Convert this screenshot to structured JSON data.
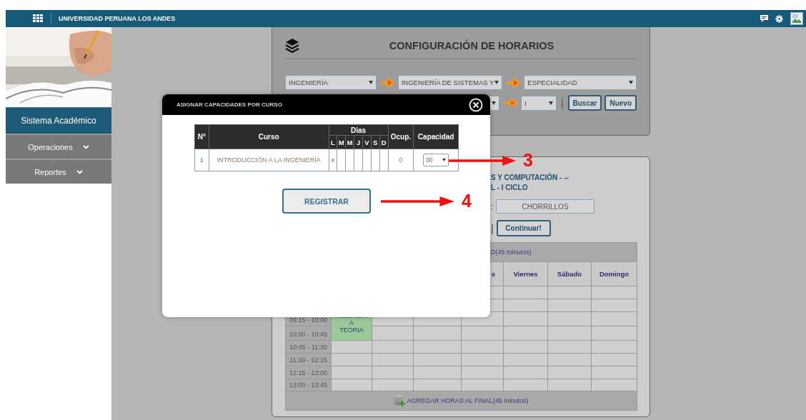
{
  "topbar": {
    "title": "UNIVERSIDAD PERUANA LOS ANDES"
  },
  "sidebar": {
    "header": "Sistema Académico",
    "items": [
      {
        "label": "Operaciones",
        "expanded": false
      },
      {
        "label": "Reportes",
        "expanded": false
      }
    ]
  },
  "config": {
    "title": "CONFIGURACIÓN DE HORARIOS",
    "row1": [
      "INGENIERÍA",
      "INGENIERÍA DE SISTEMAS Y",
      "ESPECIALIDAD"
    ],
    "row2_select": "I",
    "separator": "|",
    "buttons": [
      "Buscar",
      "Nuevo"
    ]
  },
  "schedule": {
    "heading_lines": [
      "S Y COMPUTACIÓN - --",
      "L - I CICLO"
    ],
    "location_label": ":",
    "location_value": "CHORRILLOS",
    "separator": "|",
    "continue_button": "Continuar!",
    "add_start_link": "D(45 minutos)",
    "days": [
      "s",
      "Viernes",
      "Sábado",
      "Domingo"
    ],
    "rows": [
      {
        "time": "09:15 - 10:00",
        "course": "INGENIERI\nA\nTEORIA"
      },
      {
        "time": "10:00 - 10:45"
      },
      {
        "time": "10:45 - 11:30"
      },
      {
        "time": "11:30 - 12:15"
      },
      {
        "time": "12:15 - 13:00"
      },
      {
        "time": "13:00 - 13:45"
      }
    ],
    "add_end_link": "AGREGAR HORAS AL FINAL(45 minutos)"
  },
  "dialog": {
    "title": "ASIGNAR CAPACIDADES POR CURSO",
    "columns": {
      "number": "N°",
      "course": "Curso",
      "days": "Dias",
      "day_letters": [
        "L",
        "M",
        "M",
        "J",
        "V",
        "S",
        "D"
      ],
      "occupied": "Ocup.",
      "capacity": "Capacidad"
    },
    "rows": [
      {
        "number": "1",
        "course": "INTRODUCCIÓN A LA INGENIERÍA",
        "days": [
          "x"
        ],
        "occupied": "0",
        "capacity": "00"
      }
    ],
    "button": "REGISTRAR"
  },
  "annotations": [
    {
      "label": "3"
    },
    {
      "label": "4"
    }
  ]
}
